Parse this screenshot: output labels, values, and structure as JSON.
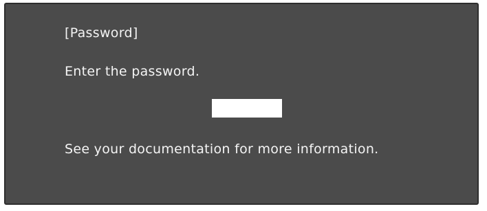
{
  "dialog": {
    "title": "[Password]",
    "prompt": "Enter the password.",
    "password_value": "",
    "info": "See your documentation for more information."
  },
  "colors": {
    "background": "#4b4b4b",
    "text": "#f4f4f4",
    "field": "#ffffff"
  }
}
